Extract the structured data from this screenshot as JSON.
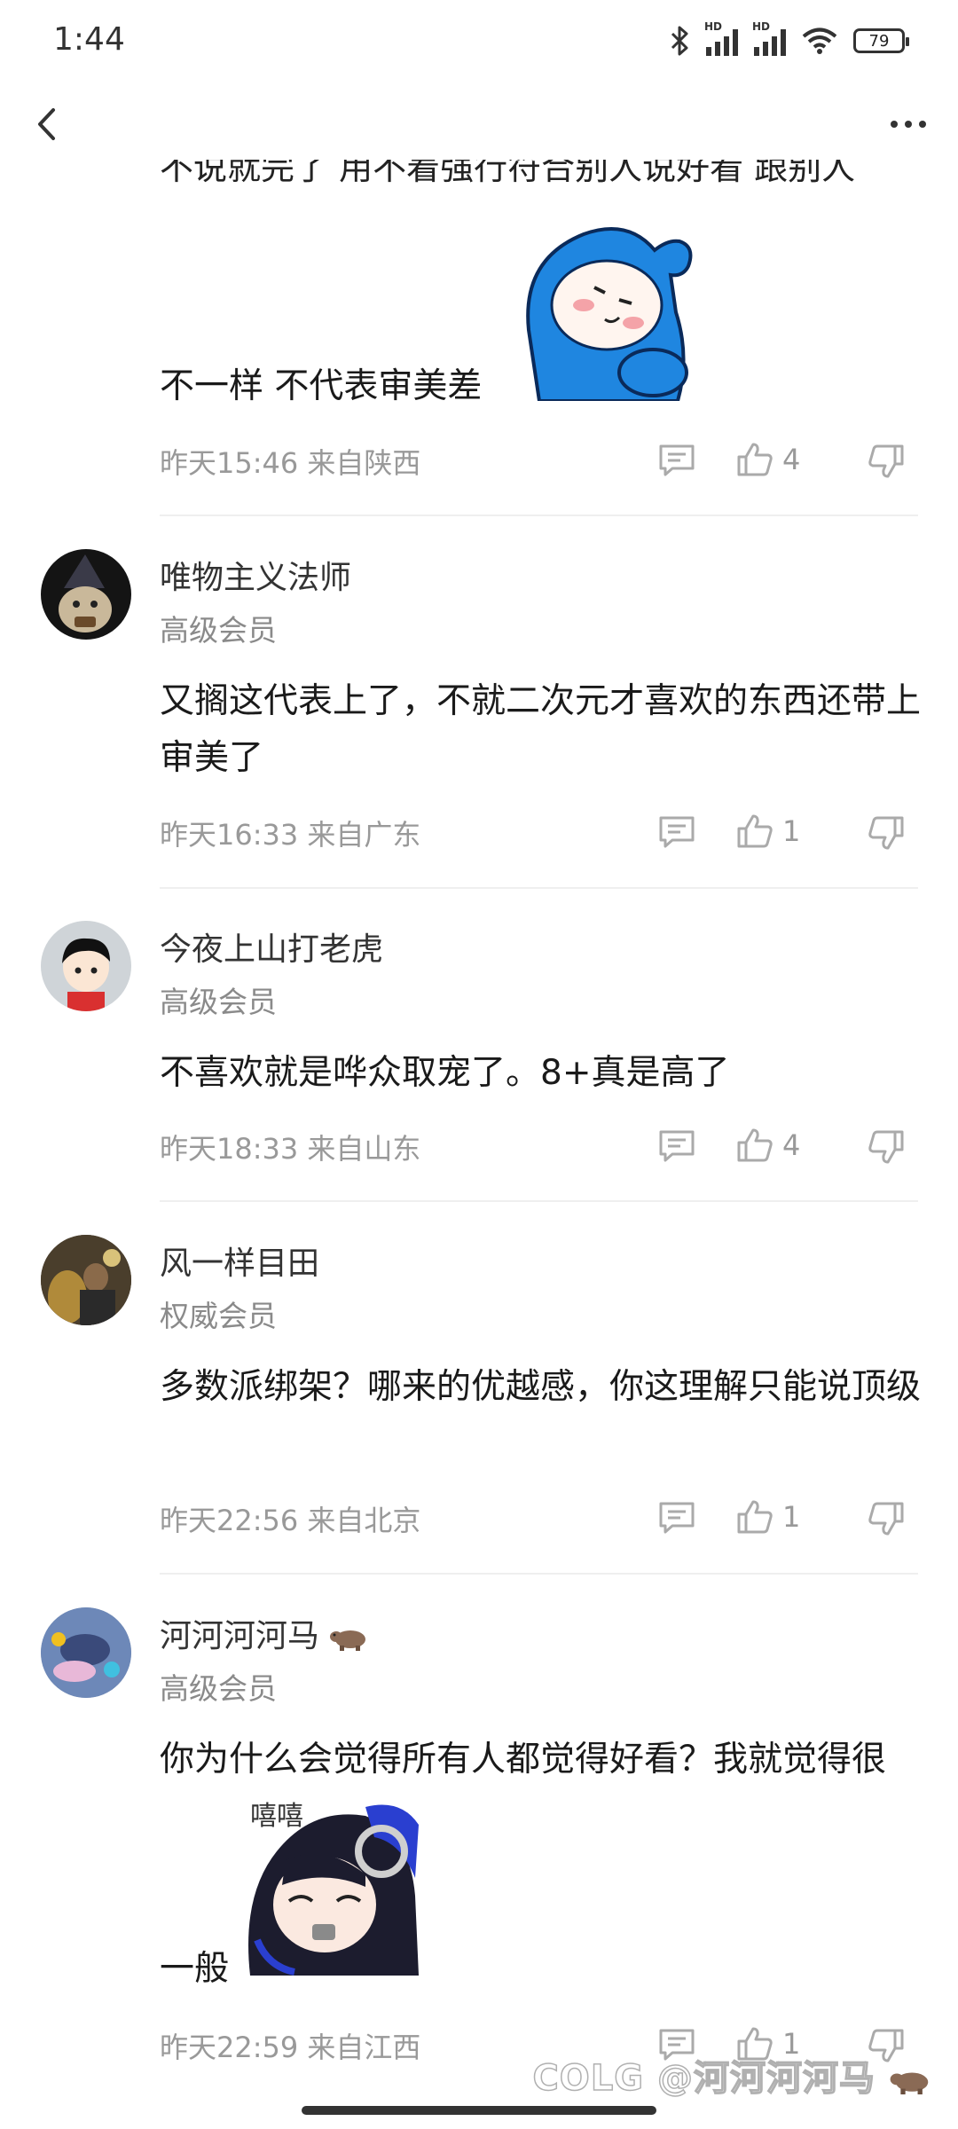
{
  "status": {
    "time": "1:44",
    "battery": "79",
    "hd1": "HD",
    "hd2": "HD"
  },
  "nav": {
    "back_icon": "chevron-left-icon",
    "more_icon": "more-dots-icon"
  },
  "partial_comment": {
    "cut_line": "不说就完了 用不着强行符合别人说好看 跟别人",
    "text_end": "不一样 不代表审美差",
    "meta": "昨天15:46 来自陕西",
    "likes": "4"
  },
  "comments": [
    {
      "username": "唯物主义法师",
      "level": "高级会员",
      "text": "又搁这代表上了，不就二次元才喜欢的东西还带上审美了",
      "meta": "昨天16:33 来自广东",
      "likes": "1"
    },
    {
      "username": "今夜上山打老虎",
      "level": "高级会员",
      "text": "不喜欢就是哗众取宠了。8+真是高了",
      "meta": "昨天18:33 来自山东",
      "likes": "4"
    },
    {
      "username": "风一样目田",
      "level": "权威会员",
      "text": "多数派绑架？哪来的优越感，你这理解只能说顶级",
      "meta": "昨天22:56 来自北京",
      "likes": "1"
    },
    {
      "username": "河河河河马",
      "level": "高级会员",
      "text": "你为什么会觉得所有人都觉得好看？我就觉得很",
      "text_end": "一般",
      "sticker_text": "嘻嘻",
      "meta": "昨天22:59 来自江西",
      "likes": "1"
    }
  ],
  "watermark": "COLG @河河河河马",
  "colors": {
    "background": "#ffffff",
    "text": "#1a1a1a",
    "meta": "#999999",
    "sticker_blue": "#1f86e0"
  }
}
